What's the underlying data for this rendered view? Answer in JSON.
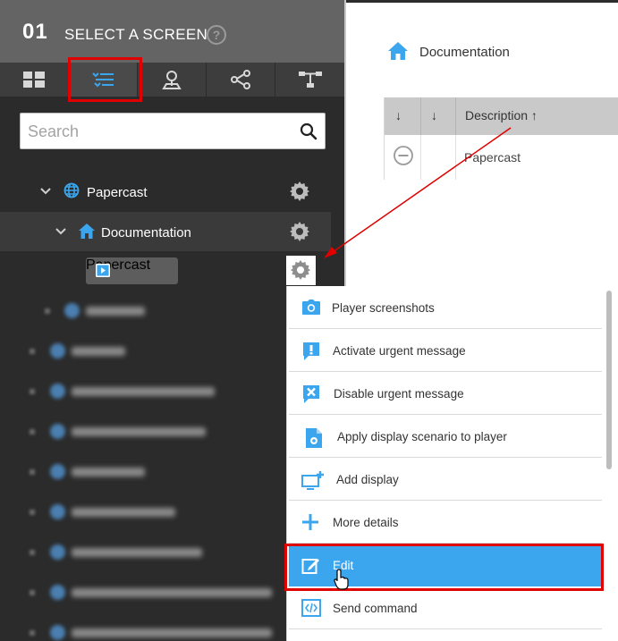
{
  "header": {
    "step_number": "01",
    "title": "SELECT A SCREEN",
    "help_glyph": "?"
  },
  "tabs": [
    {
      "icon": "grid-icon",
      "active": false
    },
    {
      "icon": "tree-list-icon",
      "active": true
    },
    {
      "icon": "map-pin-icon",
      "active": false
    },
    {
      "icon": "share-icon",
      "active": false
    },
    {
      "icon": "hierarchy-icon",
      "active": false
    }
  ],
  "search": {
    "placeholder": "Search",
    "value": ""
  },
  "tree": {
    "root": {
      "label": "Papercast",
      "icon": "globe-icon"
    },
    "child": {
      "label": "Documentation",
      "icon": "home-icon"
    },
    "leaf": {
      "label": "Papercast",
      "icon": "play-icon"
    }
  },
  "breadcrumb": {
    "label": "Documentation"
  },
  "table": {
    "columns": [
      "↓",
      "↓",
      "Description ↑"
    ],
    "more_glyph": "⋮",
    "rows": [
      {
        "description": "Papercast"
      }
    ]
  },
  "context_menu": {
    "items": [
      {
        "label": "Player screenshots",
        "icon": "camera-icon"
      },
      {
        "label": "Activate urgent message",
        "icon": "alert-message-icon"
      },
      {
        "label": "Disable urgent message",
        "icon": "close-message-icon"
      },
      {
        "label": "Apply display scenario to player",
        "icon": "file-gear-icon"
      },
      {
        "label": "Add display",
        "icon": "add-display-icon"
      },
      {
        "label": "More details",
        "icon": "plus-icon"
      },
      {
        "label": "Edit",
        "icon": "edit-icon"
      },
      {
        "label": "Send command",
        "icon": "code-icon"
      }
    ],
    "hovered_label": "Edit"
  },
  "colors": {
    "accent": "#3ba6ee",
    "highlight": "#e00000",
    "panel_dark": "#2b2b2b",
    "panel_header": "#646464"
  }
}
